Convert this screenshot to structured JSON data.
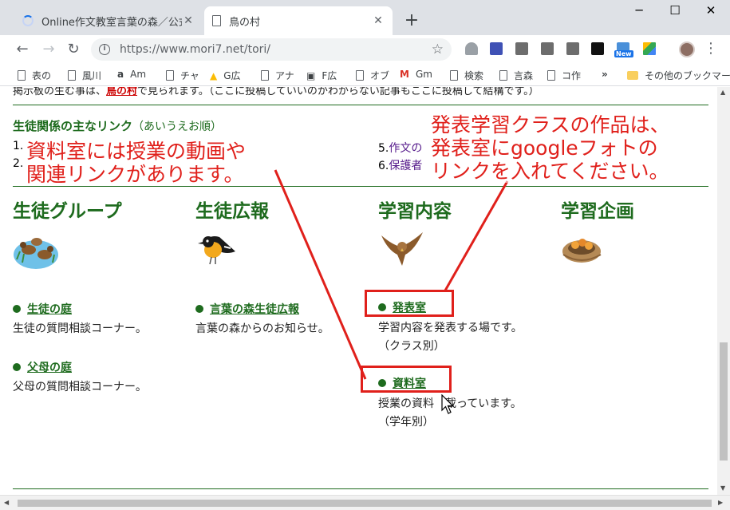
{
  "browser": {
    "tabs": [
      {
        "title": "Online作文教室言葉の森／公式ホ",
        "close": "✕"
      },
      {
        "title": "鳥の村",
        "close": "✕"
      }
    ],
    "new_tab": "+",
    "window_controls": {
      "minimize": "─",
      "maximize": "☐",
      "close": "✕"
    },
    "nav": {
      "back": "←",
      "forward": "→",
      "reload": "↻"
    },
    "url": "https://www.mori7.net/tori/",
    "star": "☆",
    "ext_badge": "New",
    "menu": "⋮",
    "bookmarks": [
      {
        "label": "表の",
        "icon": "page"
      },
      {
        "label": "風川",
        "icon": "page"
      },
      {
        "label": "Am",
        "icon": "amazon"
      },
      {
        "label": "チャ",
        "icon": "page"
      },
      {
        "label": "G広",
        "icon": "google-ads"
      },
      {
        "label": "アナ",
        "icon": "page"
      },
      {
        "label": "F広",
        "icon": "floppy"
      },
      {
        "label": "オブ",
        "icon": "page"
      },
      {
        "label": "Gm",
        "icon": "gmail"
      },
      {
        "label": "検索",
        "icon": "page"
      },
      {
        "label": "言森",
        "icon": "page"
      },
      {
        "label": "コ作",
        "icon": "page"
      }
    ],
    "bookmarks_more": "»",
    "bookmarks_other": "その他のブックマーク"
  },
  "page": {
    "cut_line": {
      "pre": "掲示板の生む事は、",
      "link": "鳥の村",
      "post": "で見られます。（ここに投稿していいのかわからない記事もここに投稿して結構です。）"
    },
    "links_section": {
      "title": "生徒関係の主なリンク",
      "subtitle": "（あいうえお順）",
      "items_left": [
        "1.",
        "2."
      ],
      "items_right": [
        {
          "num": "5.",
          "text": "作文の"
        },
        {
          "num": "6.",
          "text": "保護者"
        }
      ]
    },
    "columns": [
      {
        "heading": "生徒グループ",
        "items": [
          {
            "link": "生徒の庭",
            "desc": [
              "生徒の質問相談コーナー。"
            ]
          },
          {
            "link": "父母の庭",
            "desc": [
              "父母の質問相談コーナー。"
            ]
          }
        ]
      },
      {
        "heading": "生徒広報",
        "items": [
          {
            "link": "言葉の森生徒広報",
            "desc": [
              "言葉の森からのお知らせ。"
            ]
          }
        ]
      },
      {
        "heading": "学習内容",
        "items": [
          {
            "link": "発表室",
            "desc": [
              "学習内容を発表する場です。",
              "（クラス別）"
            ]
          },
          {
            "link": "資料室",
            "desc": [
              "授業の資料",
              "載っています。",
              "（学年別）"
            ]
          }
        ]
      },
      {
        "heading": "学習企画",
        "items": []
      }
    ],
    "annotations": {
      "left": [
        "資料室には授業の動画や",
        "関連リンクがあります。"
      ],
      "right": [
        "発表学習クラスの作品は、",
        "発表室にgoogleフォトの",
        "リンクを入れてください。"
      ]
    }
  },
  "colors": {
    "heading_green": "#1e6b1e",
    "annotation_red": "#e0201b",
    "visited_purple": "#551a8b"
  }
}
